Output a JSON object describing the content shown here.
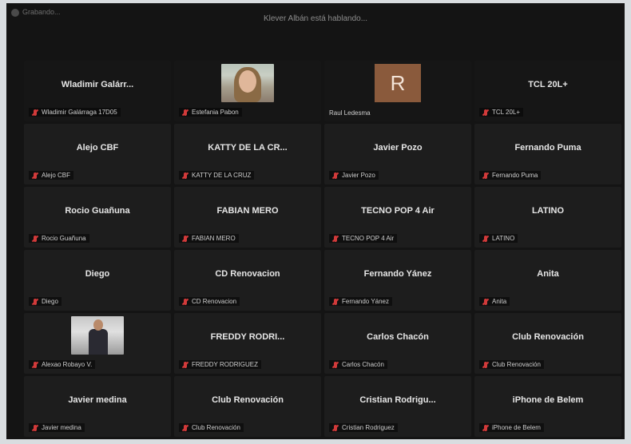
{
  "topbar": {
    "recording_label": "Grabando...",
    "speaking_text": "Klever Albán está hablando..."
  },
  "participants": [
    {
      "display": "Wladimir Galárr...",
      "label": "Wladimir Galárraga 17D05",
      "muted": true
    },
    {
      "display": "",
      "label": "Estefania Pabon",
      "muted": true,
      "photo": "woman"
    },
    {
      "display": "",
      "label": "Raul Ledesma",
      "muted": false,
      "avatar": "R"
    },
    {
      "display": "TCL 20L+",
      "label": "TCL 20L+",
      "muted": true
    },
    {
      "display": "Alejo CBF",
      "label": "Alejo CBF",
      "muted": true
    },
    {
      "display": "KATTY DE LA CR...",
      "label": "KATTY DE LA CRUZ",
      "muted": true
    },
    {
      "display": "Javier Pozo",
      "label": "Javier Pozo",
      "muted": true
    },
    {
      "display": "Fernando Puma",
      "label": "Fernando Puma",
      "muted": true
    },
    {
      "display": "Rocio Guañuna",
      "label": "Rocio Guañuna",
      "muted": true
    },
    {
      "display": "FABIAN MERO",
      "label": "FABIAN MERO",
      "muted": true
    },
    {
      "display": "TECNO POP 4 Air",
      "label": "TECNO POP 4 Air",
      "muted": true
    },
    {
      "display": "LATINO",
      "label": "LATINO",
      "muted": true
    },
    {
      "display": "Diego",
      "label": "Diego",
      "muted": true
    },
    {
      "display": "CD Renovacion",
      "label": "CD Renovacion",
      "muted": true
    },
    {
      "display": "Fernando Yánez",
      "label": "Fernando Yánez",
      "muted": true
    },
    {
      "display": "Anita",
      "label": "Anita",
      "muted": true
    },
    {
      "display": "",
      "label": "Alexao Robayo V.",
      "muted": true,
      "photo": "man"
    },
    {
      "display": "FREDDY RODRI...",
      "label": "FREDDY RODRIGUEZ",
      "muted": true
    },
    {
      "display": "Carlos Chacón",
      "label": "Carlos Chacón",
      "muted": true
    },
    {
      "display": "Club Renovación",
      "label": "Club Renovación",
      "muted": true
    },
    {
      "display": "Javier medina",
      "label": "Javier medina",
      "muted": true
    },
    {
      "display": "Club Renovación",
      "label": "Club Renovación",
      "muted": true
    },
    {
      "display": "Cristian Rodrigu...",
      "label": "Cristian Rodriguez",
      "muted": true
    },
    {
      "display": "iPhone de Belem",
      "label": "iPhone de Belem",
      "muted": true
    }
  ],
  "colors": {
    "mic_off": "#d23a3a",
    "avatar_bg": "#8a5a3c"
  },
  "icons": {
    "mic_off": "mic-off-icon",
    "recording": "record-icon"
  }
}
